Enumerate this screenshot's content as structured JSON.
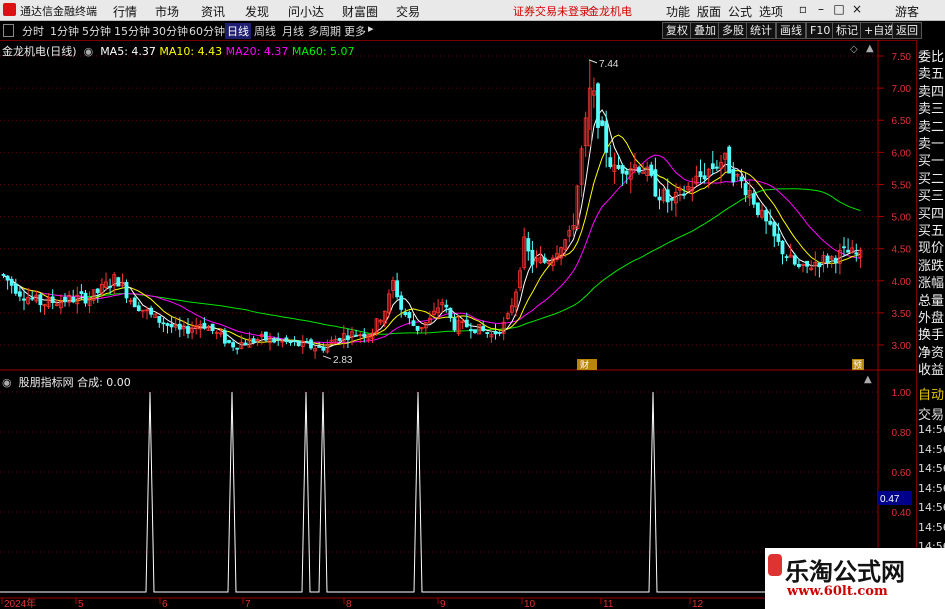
{
  "window": {
    "app_name": "通达信金融终端",
    "notice": "证券交易未登录",
    "stock_name": "金龙机电",
    "guest": "游客"
  },
  "menu": [
    "行情",
    "市场",
    "资讯",
    "发现",
    "问小达",
    "财富圈",
    "交易"
  ],
  "right_menu": [
    "功能",
    "版面",
    "公式",
    "选项"
  ],
  "periods": [
    {
      "label": "分时",
      "active": false
    },
    {
      "label": "1分钟",
      "active": false
    },
    {
      "label": "5分钟",
      "active": false
    },
    {
      "label": "15分钟",
      "active": false
    },
    {
      "label": "30分钟",
      "active": false
    },
    {
      "label": "60分钟",
      "active": false
    },
    {
      "label": "日线",
      "active": true
    },
    {
      "label": "周线",
      "active": false
    },
    {
      "label": "月线",
      "active": false
    },
    {
      "label": "多周期",
      "active": false
    },
    {
      "label": "更多",
      "active": false
    }
  ],
  "tools": [
    "复权",
    "叠加",
    "多股",
    "统计",
    "画线",
    "F10",
    "标记",
    "+自选",
    "返回"
  ],
  "main_legend": {
    "title": "金龙机电(日线)",
    "ma5": "MA5: 4.37",
    "ma10": "MA10: 4.43",
    "ma20": "MA20: 4.37",
    "ma60": "MA60: 5.07"
  },
  "indicator_legend": {
    "title": "股朋指标网",
    "value": "合成: 0.00"
  },
  "markers": {
    "high": "7.44",
    "low": "2.83",
    "fin1": "财",
    "fin2": "预"
  },
  "dates": [
    "2024年",
    "5",
    "6",
    "7",
    "8",
    "9",
    "10",
    "11",
    "12"
  ],
  "price_ticks": [
    "7.50",
    "7.00",
    "6.50",
    "6.00",
    "5.50",
    "5.00",
    "4.50",
    "4.00",
    "3.50",
    "3.00"
  ],
  "ind_ticks": [
    "1.00",
    "0.80",
    "0.60",
    "0.40",
    "0.20"
  ],
  "ind_current": "0.47",
  "right_panel": {
    "top": [
      "委比",
      "卖五",
      "卖四",
      "卖三",
      "卖二",
      "卖一",
      "买一",
      "买二",
      "买三",
      "买四",
      "买五",
      "现价",
      "涨跌",
      "涨幅",
      "总量",
      "外盘",
      "换手",
      "净资",
      "收益"
    ],
    "bottom": [
      "自动",
      "交易",
      "14:56",
      "14:56",
      "14:56",
      "14:56",
      "14:56",
      "14:56",
      "14:56",
      "14:56"
    ]
  },
  "watermark": {
    "title": "乐淘公式网",
    "url": "www.60lt.com"
  },
  "colors": {
    "up": "#ff3232",
    "down": "#54fcfc",
    "ma5": "#ffffff",
    "ma10": "#ffff00",
    "ma20": "#ff00ff",
    "ma60": "#00e600",
    "grid": "#700000"
  },
  "chart_data": [
    {
      "type": "candlestick",
      "series": [
        {
          "name": "MA5",
          "current": 4.37
        },
        {
          "name": "MA10",
          "current": 4.43
        },
        {
          "name": "MA20",
          "current": 4.37
        },
        {
          "name": "MA60",
          "current": 5.07
        }
      ],
      "ylim": [
        2.7,
        7.7
      ],
      "x_ticks": [
        "2024年",
        "5",
        "6",
        "7",
        "8",
        "9",
        "10",
        "11",
        "12"
      ],
      "ylabel": "",
      "annotations": [
        {
          "text": "7.44",
          "value": 7.44
        },
        {
          "text": "2.83",
          "value": 2.83
        }
      ]
    },
    {
      "type": "line",
      "name": "合成",
      "ylim": [
        0,
        1
      ],
      "spikes": [
        {
          "month": "6",
          "value": 1.0
        },
        {
          "month": "7",
          "value": 1.0
        },
        {
          "month": "7",
          "value": 1.0
        },
        {
          "month": "7",
          "value": 1.0
        },
        {
          "month": "9",
          "value": 1.0
        },
        {
          "month": "11",
          "value": 1.0
        }
      ],
      "current": 0.0
    }
  ]
}
